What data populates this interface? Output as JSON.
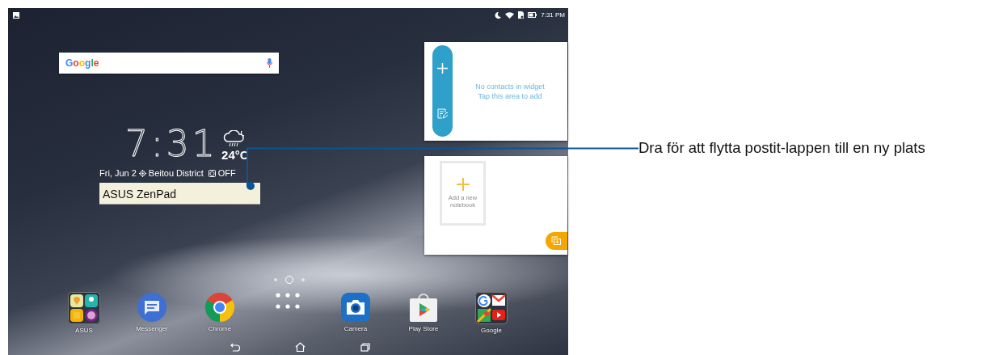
{
  "status_bar": {
    "time": "7:31 PM"
  },
  "search_widget": {
    "logo": "Google"
  },
  "clock_widget": {
    "time": "7:31",
    "temperature": "24°C",
    "date": "Fri, Jun 2",
    "location": "Beitou District",
    "alarm": "OFF"
  },
  "note_widget": {
    "text": "ASUS ZenPad"
  },
  "contacts_widget": {
    "message": "No contacts in widget",
    "hint": "Tap this area to add"
  },
  "notebook_widget": {
    "label": "Add a new notebook"
  },
  "page_indicator": [
    {
      "selected": false
    },
    {
      "selected": true
    },
    {
      "selected": false
    }
  ],
  "dock": [
    {
      "kind": "folder",
      "label": "ASUS"
    },
    {
      "kind": "messenger",
      "label": "Messenger"
    },
    {
      "kind": "chrome",
      "label": "Chrome"
    },
    {
      "kind": "apps"
    },
    {
      "kind": "camera",
      "label": "Camera"
    },
    {
      "kind": "playstore",
      "label": "Play Store"
    },
    {
      "kind": "gfolder",
      "label": "Google"
    }
  ],
  "callout": {
    "text": "Dra för att flytta postit-lappen till en ny plats"
  }
}
